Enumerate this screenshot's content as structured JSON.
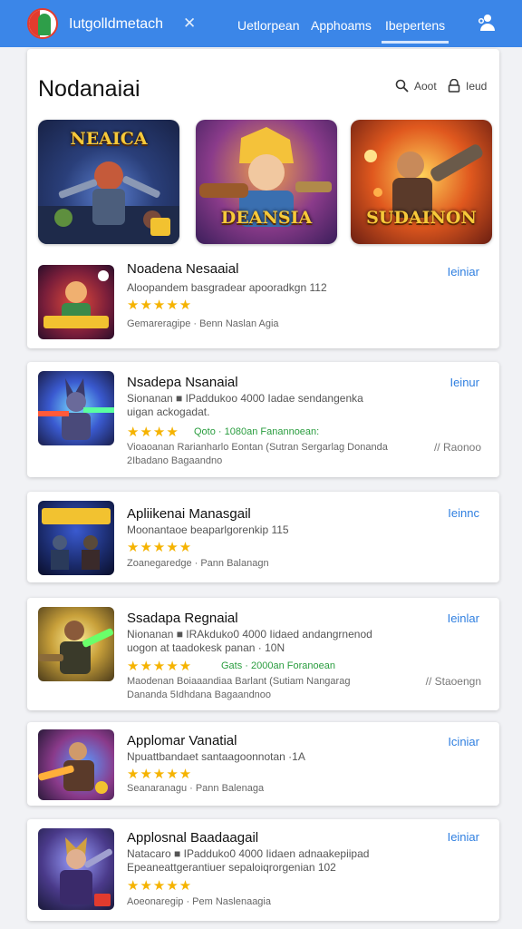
{
  "topbar": {
    "brand": "Iutgolldmetach",
    "close": "✕",
    "tabs": [
      "Uetlorpean",
      "Apphoams",
      "Ibepertens"
    ],
    "active_tab": 2
  },
  "feature": {
    "title": "Nodanaiai",
    "search_label": "Aoot",
    "lock_label": "Ieud",
    "banners": [
      {
        "label": "NEAICA"
      },
      {
        "label": "DEANSIA"
      },
      {
        "label": "SUDAINON"
      }
    ]
  },
  "apps": [
    {
      "title": "Noadena Nesaaial",
      "desc": "Aloopandem basgradear apooradkgn 112",
      "stars": "★★★★★",
      "meta": "Gemareragipe · Benn Naslan Agia",
      "install": "Ieiniar"
    },
    {
      "title": "Nsadepa Nsanaial",
      "desc": "Sionanan ■ IPaddukoo 4000 Iadae sendangenka uigan ackogadat.",
      "stars": "★★★★",
      "green": "Qoto · 1080an Fanannoean:",
      "meta": "Vioaoanan Rarianharlo Eontan (Sutran Sergarlag Donanda 2Ibadano Bagaandno",
      "right": "// Raonoo",
      "install": "Ieinur"
    },
    {
      "title": "Apliikenai Manasgail",
      "desc": "Moonantaoe beaparlgorenkip 115",
      "stars": "★★★★★",
      "meta": "Zoanegaredge · Pann Balanagn",
      "install": "Ieinnc"
    },
    {
      "title": "Ssadapa Regnaial",
      "desc": "Nionanan ■ IRAkduko0 4000 Iidaed andangrnenod uogon at taadokesk panan · 10N",
      "stars": "★★★★★",
      "green": "Gats · 2000an Foranoean",
      "meta": "Maodenan Boiaaandiaa Barlant (Sutiam Nangarag Dananda 5Idhdana Bagaandnoo",
      "right": "// Staoengn",
      "install": "Ieinlar"
    },
    {
      "title": "Applomar Vanatial",
      "desc": "Npuattbandaet santaagoonnotan ·1A",
      "stars": "★★★★★",
      "meta": "Seanaranagu · Pann Balenaga",
      "install": "Iciniar"
    },
    {
      "title": "Applosnal Baadaagail",
      "desc": "Natacaro ■ IPadduko0 4000 Iidaen adnaakepiipad Epeaneattgerantiuer sepaloiqrorgenian 102",
      "stars": "★★★★★",
      "meta": "Aoeonaregip · Pem Naslenaagia",
      "install": "Ieiniar"
    }
  ],
  "colors": {
    "accent": "#3b86e8",
    "install": "#2f7fe0",
    "stars": "#f5b301",
    "green": "#2a9d3f"
  }
}
